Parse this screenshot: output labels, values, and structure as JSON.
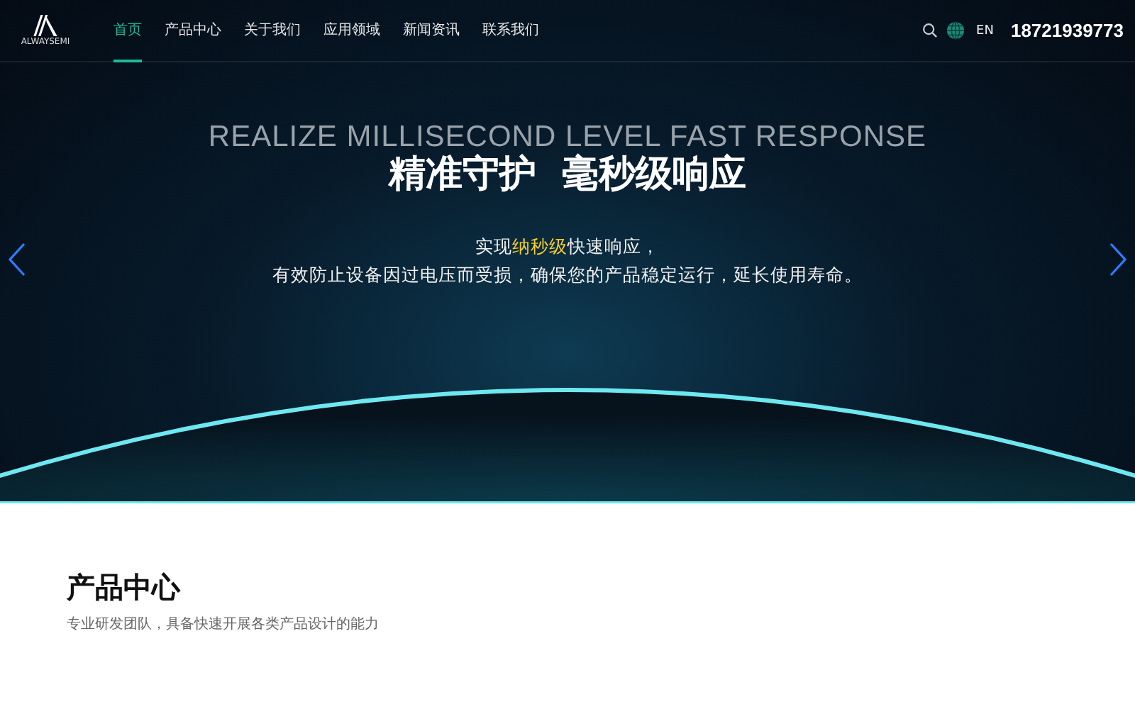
{
  "header": {
    "logo_text": "ALWAYSEMI",
    "nav": [
      {
        "label": "首页",
        "selected": true
      },
      {
        "label": "产品中心",
        "selected": false
      },
      {
        "label": "关于我们",
        "selected": false
      },
      {
        "label": "应用领域",
        "selected": false
      },
      {
        "label": "新闻资讯",
        "selected": false
      },
      {
        "label": "联系我们",
        "selected": false
      }
    ],
    "language": "EN",
    "phone": "18721939773"
  },
  "hero": {
    "eyebrow": "REALIZE MILLISECOND LEVEL FAST RESPONSE",
    "title": "精准守护  毫秒级响应",
    "subtitle_line_1": [
      {
        "text": "实现",
        "highlight": false
      },
      {
        "text": "纳秒级",
        "highlight": true
      },
      {
        "text": "快速响应，",
        "highlight": false
      }
    ],
    "subtitle_line_2": "有效防止设备因过电压而受损，确保您的产品稳定运行，延长使用寿命。"
  },
  "section": {
    "title": "产品中心",
    "subtitle": "专业研发团队，具备快速开展各类产品设计的能力"
  }
}
